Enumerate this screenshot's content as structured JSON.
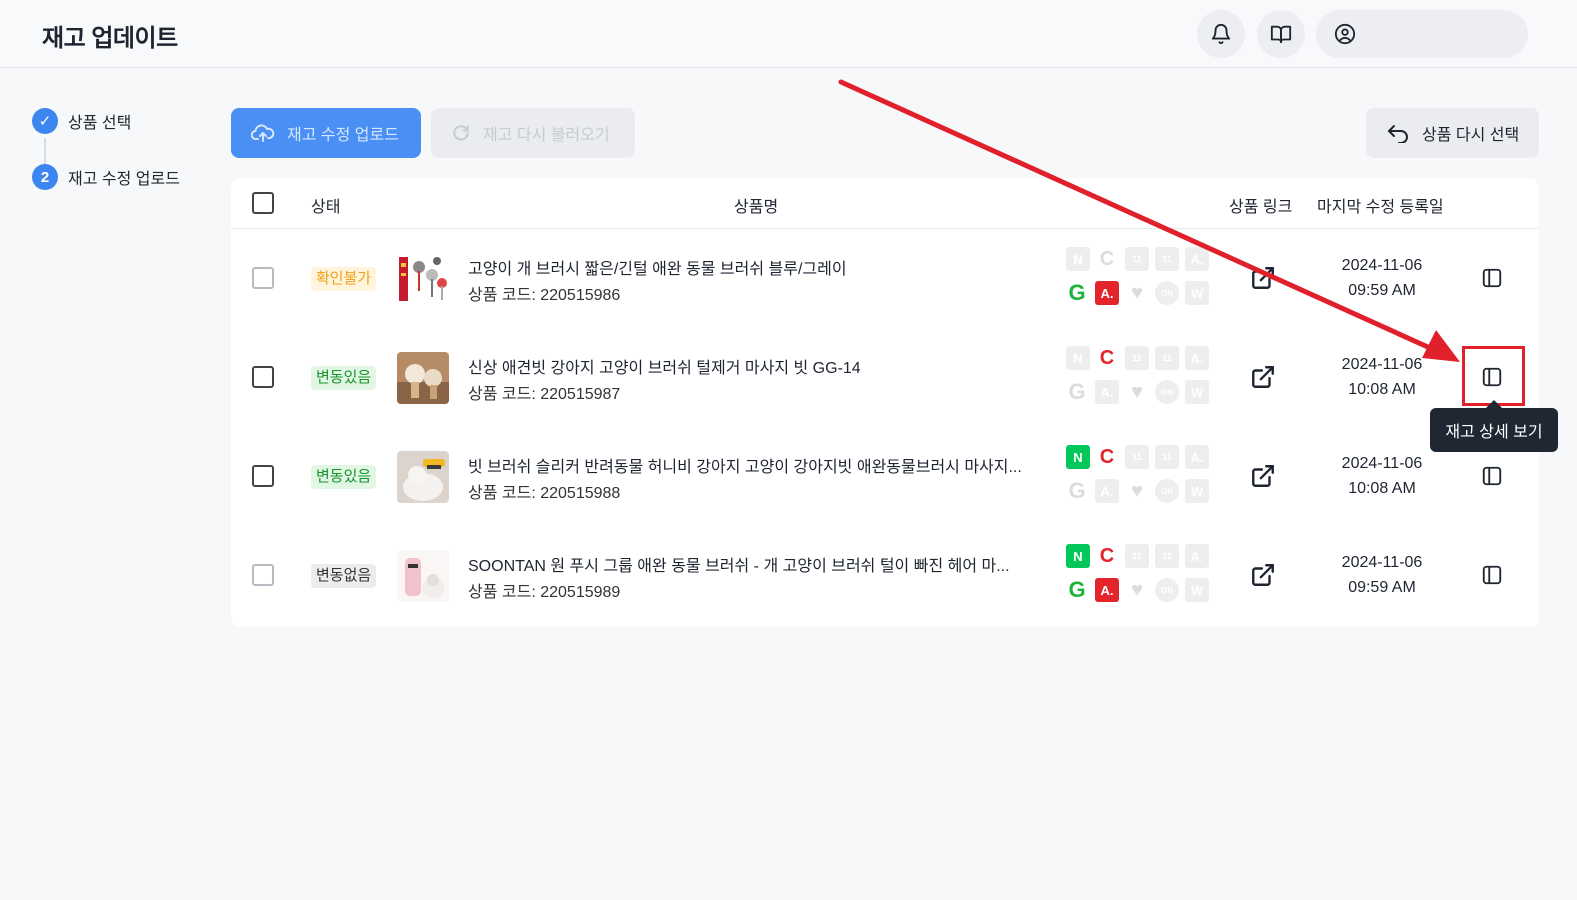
{
  "header": {
    "title": "재고 업데이트",
    "bell_icon": "bell-icon",
    "book_icon": "book-icon",
    "user_icon": "user-circle-icon"
  },
  "steps": [
    {
      "marker": "✓",
      "label": "상품 선택",
      "state": "done"
    },
    {
      "marker": "2",
      "label": "재고 수정 업로드",
      "state": "current"
    }
  ],
  "toolbar": {
    "upload_label": "재고 수정 업로드",
    "reload_label": "재고 다시 불러오기",
    "reselect_label": "상품 다시 선택"
  },
  "table": {
    "columns": {
      "status": "상태",
      "name": "상품명",
      "link": "상품 링크",
      "last_modified": "마지막 수정 등록일"
    },
    "code_prefix": "상품 코드: ",
    "rows": [
      {
        "status": "확인불가",
        "status_type": "warn",
        "name": "고양이 개 브러시 짧은/긴털 애완 동물 브러쉬 블루/그레이",
        "code": "220515986",
        "date": "2024-11-06",
        "time": "09:59 AM",
        "markets_on": [
          "G",
          "A"
        ]
      },
      {
        "status": "변동있음",
        "status_type": "change",
        "name": "신상 애견빗 강아지 고양이 브러쉬 털제거 마사지 빗 GG-14",
        "code": "220515987",
        "date": "2024-11-06",
        "time": "10:08 AM",
        "markets_on": [
          "C"
        ]
      },
      {
        "status": "변동있음",
        "status_type": "change",
        "name": "빗 브러쉬 슬리커 반려동물 허니비 강아지 고양이 강아지빗 애완동물브러시 마사지...",
        "code": "220515988",
        "date": "2024-11-06",
        "time": "10:08 AM",
        "markets_on": [
          "N",
          "C"
        ]
      },
      {
        "status": "변동없음",
        "status_type": "none",
        "name": "SOONTAN 원 푸시 그룹 애완 동물 브러쉬 - 개 고양이 브러쉬 털이 빠진 헤어 마...",
        "code": "220515989",
        "date": "2024-11-06",
        "time": "09:59 AM",
        "markets_on": [
          "N",
          "C",
          "G",
          "A"
        ]
      }
    ]
  },
  "market_labels": {
    "n": "N",
    "c": "C",
    "e1": "11",
    "e2": "11",
    "a": "A.",
    "on": "ON",
    "w": "W"
  },
  "tooltip": {
    "text": "재고 상세 보기"
  },
  "colors": {
    "primary": "#4a8ff3",
    "highlight": "#e0212c",
    "warn": "#f0a019",
    "change": "#17942c"
  }
}
